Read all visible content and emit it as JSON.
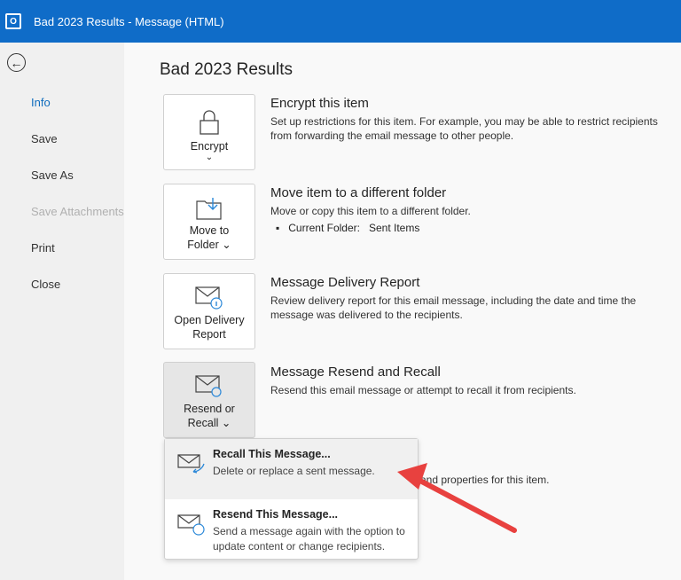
{
  "window": {
    "title": "Bad 2023 Results  -  Message (HTML)",
    "app_icon_label": "O"
  },
  "sidebar": {
    "items": [
      {
        "label": "Info"
      },
      {
        "label": "Save"
      },
      {
        "label": "Save As"
      },
      {
        "label": "Save Attachments"
      },
      {
        "label": "Print"
      },
      {
        "label": "Close"
      }
    ]
  },
  "main": {
    "title": "Bad 2023 Results",
    "sections": [
      {
        "button": "Encrypt",
        "chev": "⌄",
        "heading": "Encrypt this item",
        "desc": "Set up restrictions for this item. For example, you may be able to restrict recipients from forwarding the email message to other people."
      },
      {
        "button1": "Move to",
        "button2": "Folder ⌄",
        "heading": "Move item to a different folder",
        "desc": "Move or copy this item to a different folder.",
        "bullet_label": "Current Folder:",
        "bullet_value": "Sent Items"
      },
      {
        "button1": "Open Delivery",
        "button2": "Report",
        "heading": "Message Delivery Report",
        "desc": "Review delivery report for this email message, including the date and time the message was delivered to the recipients."
      },
      {
        "button1": "Resend or",
        "button2": "Recall ⌄",
        "heading": "Message Resend and Recall",
        "desc": "Resend this email message or attempt to recall it from recipients."
      }
    ],
    "hidden_text": "and properties for this item."
  },
  "menu": {
    "items": [
      {
        "label": "Recall This Message...",
        "desc": "Delete or replace a sent message."
      },
      {
        "label": "Resend This Message...",
        "desc": "Send a message again with the option to update content or change recipients."
      }
    ]
  },
  "colors": {
    "accent": "#0f6cbd",
    "arrow": "#e8413f"
  }
}
